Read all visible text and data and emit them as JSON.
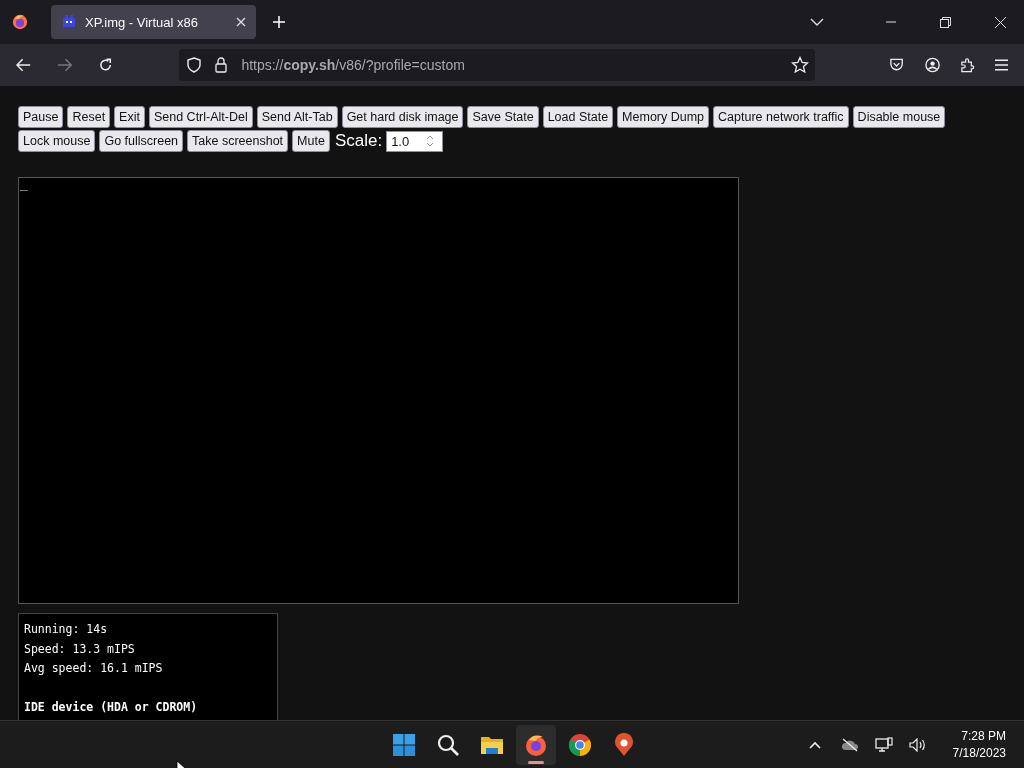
{
  "browser": {
    "tabs": [
      {
        "title": "XP.img - Virtual x86",
        "selected": true
      }
    ],
    "url": "https://**copy.sh**/v86/?profile=custom"
  },
  "controls": {
    "buttons": [
      "Pause",
      "Reset",
      "Exit",
      "Send Ctrl-Alt-Del",
      "Send Alt-Tab",
      "Get hard disk image",
      "Save State",
      "Load State",
      "Memory Dump",
      "Capture network traffic",
      "Disable mouse",
      "Lock mouse",
      "Go fullscreen",
      "Take screenshot",
      "Mute"
    ],
    "scale": {
      "label": "Scale:",
      "value": "1.0"
    }
  },
  "screen": {
    "cursor": "_"
  },
  "info": {
    "lines": [
      {
        "kind": "stat",
        "text": "Running: 14s"
      },
      {
        "kind": "stat",
        "text": "Speed: 13.3 mIPS"
      },
      {
        "kind": "stat",
        "text": "Avg speed: 16.1 mIPS"
      },
      {
        "kind": "heading",
        "text": "IDE device (HDA or CDROM)"
      }
    ]
  },
  "taskbar": {
    "apps": [
      {
        "kind": "start",
        "selected": false
      },
      {
        "kind": "search",
        "selected": false
      },
      {
        "kind": "files",
        "selected": false
      },
      {
        "kind": "firefox",
        "selected": true
      },
      {
        "kind": "chrome",
        "selected": false
      },
      {
        "kind": "maps",
        "selected": false
      }
    ],
    "clock": {
      "time": "7:28 PM",
      "date": "7/18/2023"
    }
  }
}
